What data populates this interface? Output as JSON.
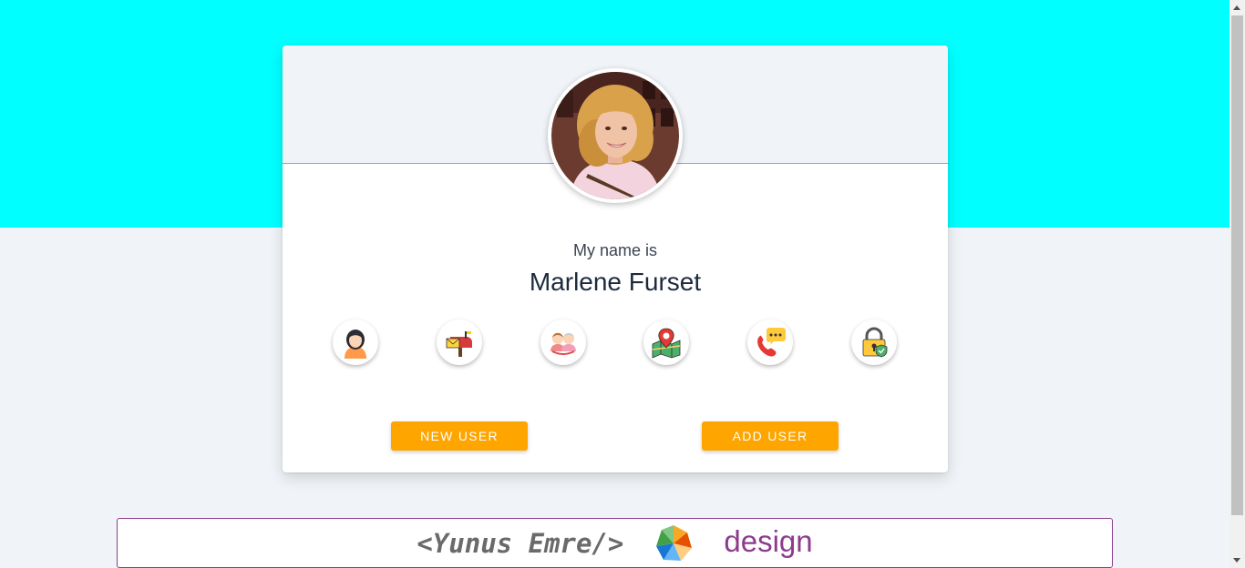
{
  "profile": {
    "title_label": "My name is",
    "title_value": "Marlene Furset",
    "avatar": "user-photo"
  },
  "info_icons": [
    {
      "name": "user-icon",
      "topic": "name"
    },
    {
      "name": "mailbox-icon",
      "topic": "email"
    },
    {
      "name": "family-icon",
      "topic": "age"
    },
    {
      "name": "map-pin-icon",
      "topic": "location"
    },
    {
      "name": "phone-icon",
      "topic": "phone"
    },
    {
      "name": "padlock-icon",
      "topic": "password"
    }
  ],
  "buttons": {
    "new_user": "NEW USER",
    "add_user": "ADD USER"
  },
  "footer": {
    "code_brand": "<Yunus Emre/>",
    "logo": "pinwheel-logo",
    "word_brand": "design"
  },
  "colors": {
    "hero_background": "#00ffff",
    "button_background": "#ffa500",
    "footer_accent": "#8e3a8e"
  }
}
